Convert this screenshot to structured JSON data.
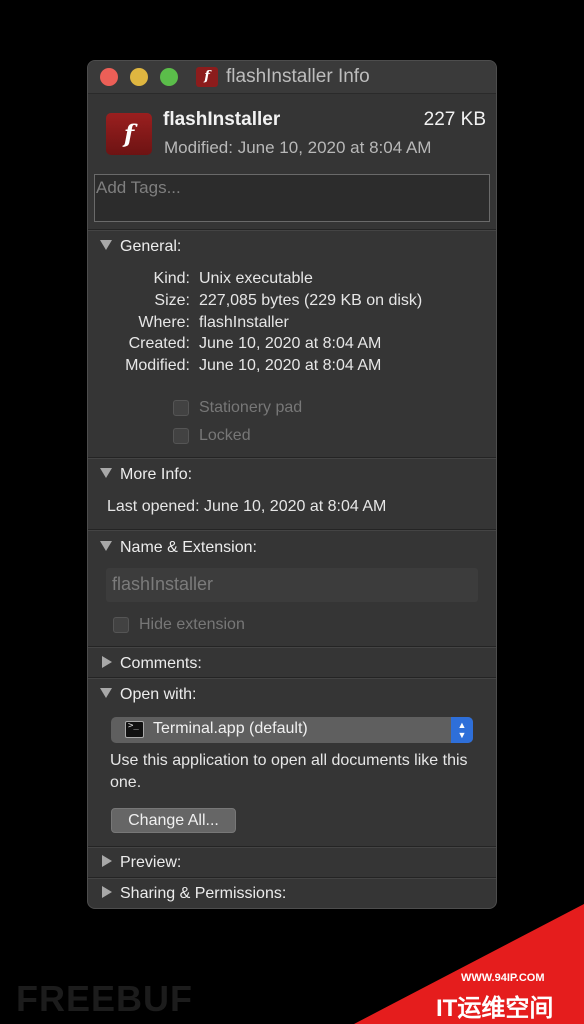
{
  "window": {
    "title": "flashInstaller Info",
    "colors": {
      "close": "#ec5f57",
      "minimize": "#dfb640",
      "maximize": "#5bbd4a",
      "accent": "#2e6fd9"
    }
  },
  "header": {
    "icon": "flash-app-icon",
    "name": "flashInstaller",
    "size": "227 KB",
    "modified": "Modified:  June 10, 2020 at 8:04 AM"
  },
  "tags": {
    "placeholder": "Add Tags..."
  },
  "general": {
    "heading": "General:",
    "rows": [
      {
        "label": "Kind:",
        "value": "Unix executable"
      },
      {
        "label": "Size:",
        "value": "227,085 bytes (229 KB on disk)"
      },
      {
        "label": "Where:",
        "value": "flashInstaller"
      },
      {
        "label": "Created:",
        "value": "June 10, 2020 at 8:04 AM"
      },
      {
        "label": "Modified:",
        "value": "June 10, 2020 at 8:04 AM"
      }
    ],
    "stationery_label": "Stationery pad",
    "locked_label": "Locked"
  },
  "more_info": {
    "heading": "More Info:",
    "last_opened": "Last opened:  June 10, 2020 at 8:04 AM"
  },
  "name_ext": {
    "heading": "Name & Extension:",
    "name_value": "flashInstaller",
    "hide_extension_label": "Hide extension"
  },
  "comments": {
    "heading": "Comments:"
  },
  "open_with": {
    "heading": "Open with:",
    "selected_app": "Terminal.app (default)",
    "description": "Use this application to open all documents like this one.",
    "change_all_label": "Change All..."
  },
  "preview": {
    "heading": "Preview:"
  },
  "sharing": {
    "heading": "Sharing & Permissions:"
  },
  "watermark": {
    "left": "FREEBUF",
    "url": "WWW.94IP.COM",
    "brand": "IT运维空间"
  }
}
